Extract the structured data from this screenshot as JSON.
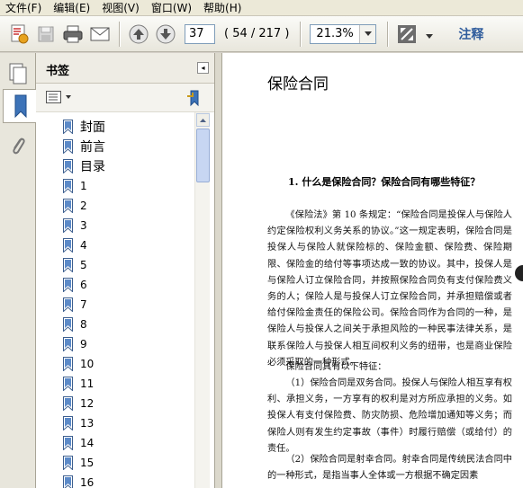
{
  "menu": [
    "文件(F)",
    "编辑(E)",
    "视图(V)",
    "窗口(W)",
    "帮助(H)"
  ],
  "toolbar": {
    "page_number": "37",
    "page_count": "( 54 / 217 )",
    "zoom": "21.3%",
    "comment_label": "注释"
  },
  "panel": {
    "title": "书签"
  },
  "bookmarks": [
    "封面",
    "前言",
    "目录",
    "1",
    "2",
    "3",
    "4",
    "5",
    "6",
    "7",
    "8",
    "9",
    "10",
    "11",
    "12",
    "13",
    "14",
    "15",
    "16"
  ],
  "document": {
    "heading": "保险合同",
    "question": "1. 什么是保险合同？保险合同有哪些特征？",
    "p1": "《保险法》第 10 条规定：“保险合同是投保人与保险人约定保险权利义务关系的协议。”这一规定表明，保险合同是投保人与保险人就保险标的、保险金额、保险费、保险期限、保险金的给付等事项达成一致的协议。其中，投保人是与保险人订立保险合同，并按照保险合同负有支付保险费义务的人；保险人是与投保人订立保险合同，并承担赔偿或者给付保险金责任的保险公司。保险合同作为合同的一种，是保险人与投保人之间关于承担风险的一种民事法律关系，是联系保险人与投保人相互间权利义务的纽带，也是商业保险必须采取的一种形式。",
    "p2": "保险合同具有以下特征：",
    "p3": "（1）保险合同是双务合同。投保人与保险人相互享有权利、承担义务，一方享有的权利是对方所应承担的义务。如投保人有支付保险费、防灾防损、危险增加通知等义务；而保险人则有发生约定事故（事件）时履行赔偿（或给付）的责任。",
    "p4": "（2）保险合同是射幸合同。射幸合同是传统民法合同中的一种形式，是指当事人全体或一方根据不确定因素"
  }
}
